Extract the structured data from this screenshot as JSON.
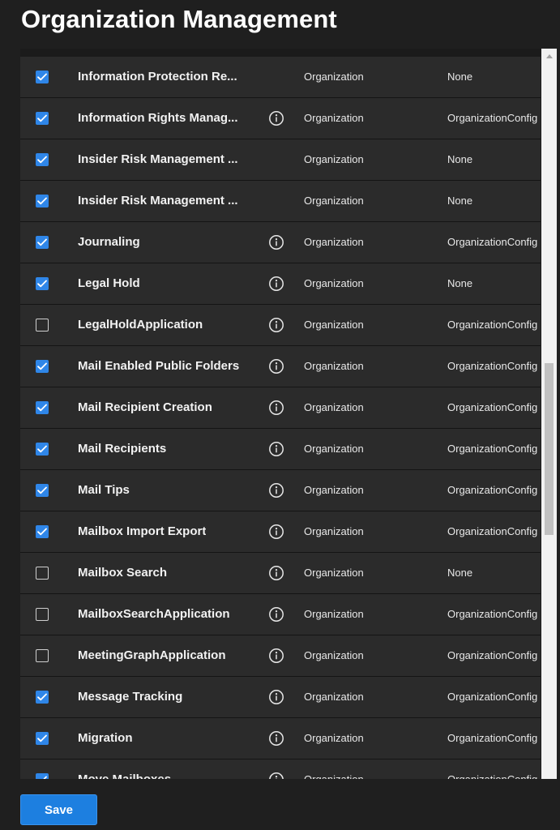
{
  "header": {
    "title": "Organization Management"
  },
  "rows": [
    {
      "name": "Information Protection Re...",
      "checked": true,
      "info": false,
      "scope": "Organization",
      "config": "None"
    },
    {
      "name": "Information Rights Manag...",
      "checked": true,
      "info": true,
      "scope": "Organization",
      "config": "OrganizationConfig"
    },
    {
      "name": "Insider Risk Management ...",
      "checked": true,
      "info": false,
      "scope": "Organization",
      "config": "None"
    },
    {
      "name": "Insider Risk Management ...",
      "checked": true,
      "info": false,
      "scope": "Organization",
      "config": "None"
    },
    {
      "name": "Journaling",
      "checked": true,
      "info": true,
      "scope": "Organization",
      "config": "OrganizationConfig"
    },
    {
      "name": "Legal Hold",
      "checked": true,
      "info": true,
      "scope": "Organization",
      "config": "None"
    },
    {
      "name": "LegalHoldApplication",
      "checked": false,
      "info": true,
      "scope": "Organization",
      "config": "OrganizationConfig"
    },
    {
      "name": "Mail Enabled Public Folders",
      "checked": true,
      "info": true,
      "scope": "Organization",
      "config": "OrganizationConfig"
    },
    {
      "name": "Mail Recipient Creation",
      "checked": true,
      "info": true,
      "scope": "Organization",
      "config": "OrganizationConfig"
    },
    {
      "name": "Mail Recipients",
      "checked": true,
      "info": true,
      "scope": "Organization",
      "config": "OrganizationConfig"
    },
    {
      "name": "Mail Tips",
      "checked": true,
      "info": true,
      "scope": "Organization",
      "config": "OrganizationConfig"
    },
    {
      "name": "Mailbox Import Export",
      "checked": true,
      "info": true,
      "scope": "Organization",
      "config": "OrganizationConfig"
    },
    {
      "name": "Mailbox Search",
      "checked": false,
      "info": true,
      "scope": "Organization",
      "config": "None"
    },
    {
      "name": "MailboxSearchApplication",
      "checked": false,
      "info": true,
      "scope": "Organization",
      "config": "OrganizationConfig"
    },
    {
      "name": "MeetingGraphApplication",
      "checked": false,
      "info": true,
      "scope": "Organization",
      "config": "OrganizationConfig"
    },
    {
      "name": "Message Tracking",
      "checked": true,
      "info": true,
      "scope": "Organization",
      "config": "OrganizationConfig"
    },
    {
      "name": "Migration",
      "checked": true,
      "info": true,
      "scope": "Organization",
      "config": "OrganizationConfig"
    },
    {
      "name": "Move Mailboxes",
      "checked": true,
      "info": true,
      "scope": "Organization",
      "config": "OrganizationConfig"
    }
  ],
  "footer": {
    "save_label": "Save"
  },
  "colors": {
    "accent": "#2f86e8",
    "row_background": "#2b2b2b",
    "page_background": "#1f1f1f"
  },
  "icons": {
    "info": "info-circle-icon",
    "checkmark": "checkmark-icon",
    "scroll_up": "chevron-up-icon"
  },
  "scroll": {
    "position_fraction": 0.42,
    "visible_fraction": 0.24
  }
}
